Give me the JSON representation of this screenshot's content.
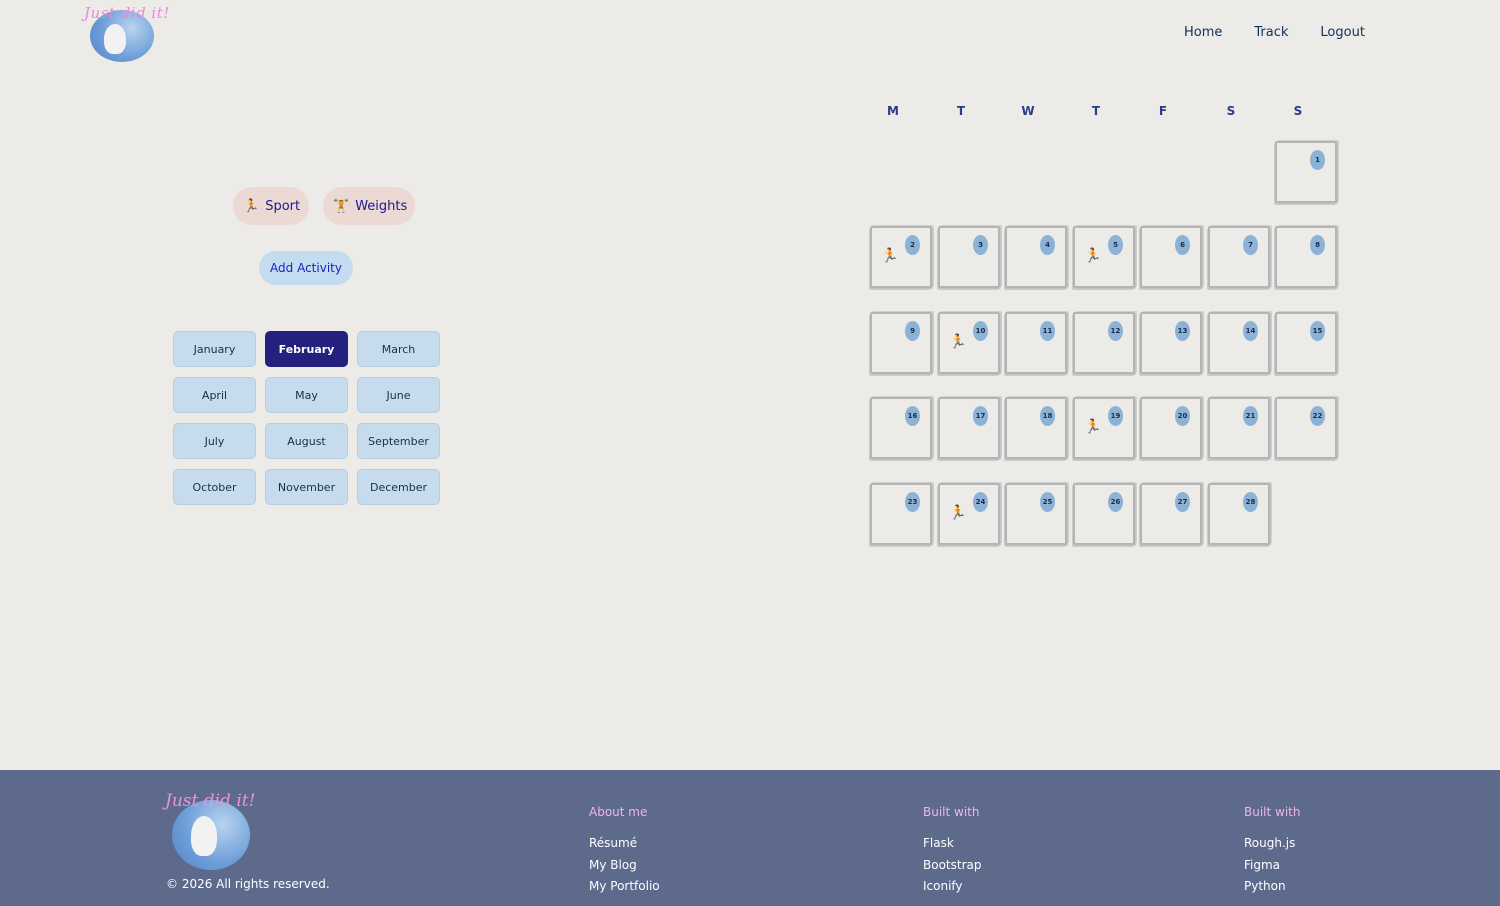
{
  "brand": {
    "logo_text": "Just did it!"
  },
  "nav": {
    "items": [
      "Home",
      "Track",
      "Logout"
    ]
  },
  "activities": [
    {
      "label": "Sport",
      "icon": "runner-icon"
    },
    {
      "label": "Weights",
      "icon": "weightlifter-icon"
    }
  ],
  "add_activity": "Add Activity",
  "months": [
    "January",
    "February",
    "March",
    "April",
    "May",
    "June",
    "July",
    "August",
    "September",
    "October",
    "November",
    "December"
  ],
  "selected_month": "February",
  "calendar": {
    "weekdays": [
      "M",
      "T",
      "W",
      "T",
      "F",
      "S",
      "S"
    ],
    "first_weekday_index": 6,
    "days_in_month": 28,
    "sport_days": [
      2,
      5,
      10,
      19,
      24
    ]
  },
  "footer": {
    "copyright": "© 2026 All rights reserved.",
    "columns": [
      {
        "title": "About me",
        "links": [
          "Résumé",
          "My Blog",
          "My Portfolio"
        ]
      },
      {
        "title": "Built with",
        "links": [
          "Flask",
          "Bootstrap",
          "Iconify"
        ]
      },
      {
        "title": "Built with",
        "links": [
          "Rough.js",
          "Figma",
          "Python"
        ]
      }
    ]
  }
}
